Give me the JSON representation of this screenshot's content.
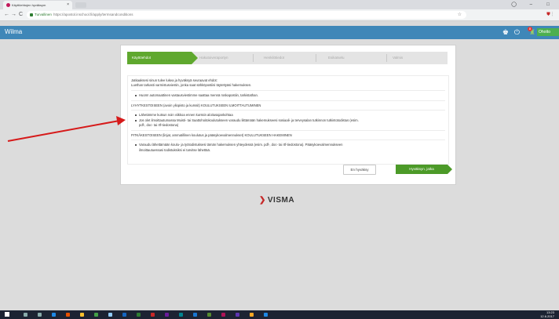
{
  "browser": {
    "tab_title": "Käyttöehtojen hyväksym",
    "tab_close": "×",
    "security_label": "Turvallinen",
    "url": "https://apostol.inschool.fi/apply/termsandconditions",
    "back": "←",
    "forward": "→",
    "reload": "C",
    "bookmark_star": "☆",
    "window_min": "–",
    "window_max": "□",
    "window_close": "×",
    "account_icon": "◯"
  },
  "app": {
    "logo": "Wilma",
    "user_label": "Ohotto",
    "notification_count": "8"
  },
  "wizard": {
    "steps": [
      "Käyttöehdot",
      "Hakutoiveraportyn",
      "Henkilötiedot",
      "Esikatselu",
      "Valmis"
    ],
    "active_step": 0
  },
  "terms": {
    "intro_1": "Jatkaaksesi sinun tulee lukea ja hyväksyä seuraavat ehdot:",
    "intro_2": "Luethan tarkasti varmistusviestin, jonka saat sähköpostiisi täytettyäsi hakemuksen.",
    "bullet_spam": "Huom! automaattinen vastausviestimme saattaa mennä roskapostiin, tarkistathan.",
    "section_short": "LYHYTKESTOISEEN (avoin yliopisto ja kurssit) KOULUTUKSEEN ILMOITTAUTUMINEN",
    "bullet_short_1": "Lähetämme kutsun noin viikkoa ennen kurssin aloitusajankohtaa",
    "bullet_short_2": "Jos olet ilmoittautumassa Muisti- tai Saattohoitokoulutukseen varaudu liittämään hakemukseesi sosiaali- ja terveysalan tutkinnon tutkintotodistus (esim.",
    "bullet_short_2b": "pdf-, doc- tai rtf-tiedostona)",
    "section_long": "PITKÄKESTOISEEN (linjat, ammatillinen koulutus ja pääsykoevalmennukset) KOULUTUKSEEN HAKEMINEN",
    "bullet_long_1": "Varaudu lähettämään koulu- ja työtodistuksesi tämän hakemuksen yhteydessä (esim. pdf-, doc- tai rtf-tiedostona). Pääsykoevalmennukseen",
    "bullet_long_1b": "ilmoittautuessasi todistuksiksi ei tarvitse lähettää."
  },
  "actions": {
    "decline": "En hyväksy",
    "accept": "Hyväksyn, jatka"
  },
  "footer": {
    "brand": "VISMA"
  },
  "taskbar": {
    "time": "13:23",
    "date": "12.6.2017"
  },
  "colors": {
    "header": "#3f87b8",
    "active_step": "#5fa82e",
    "accept_button": "#4c9a28",
    "annotation_arrow": "#d61a1a"
  }
}
